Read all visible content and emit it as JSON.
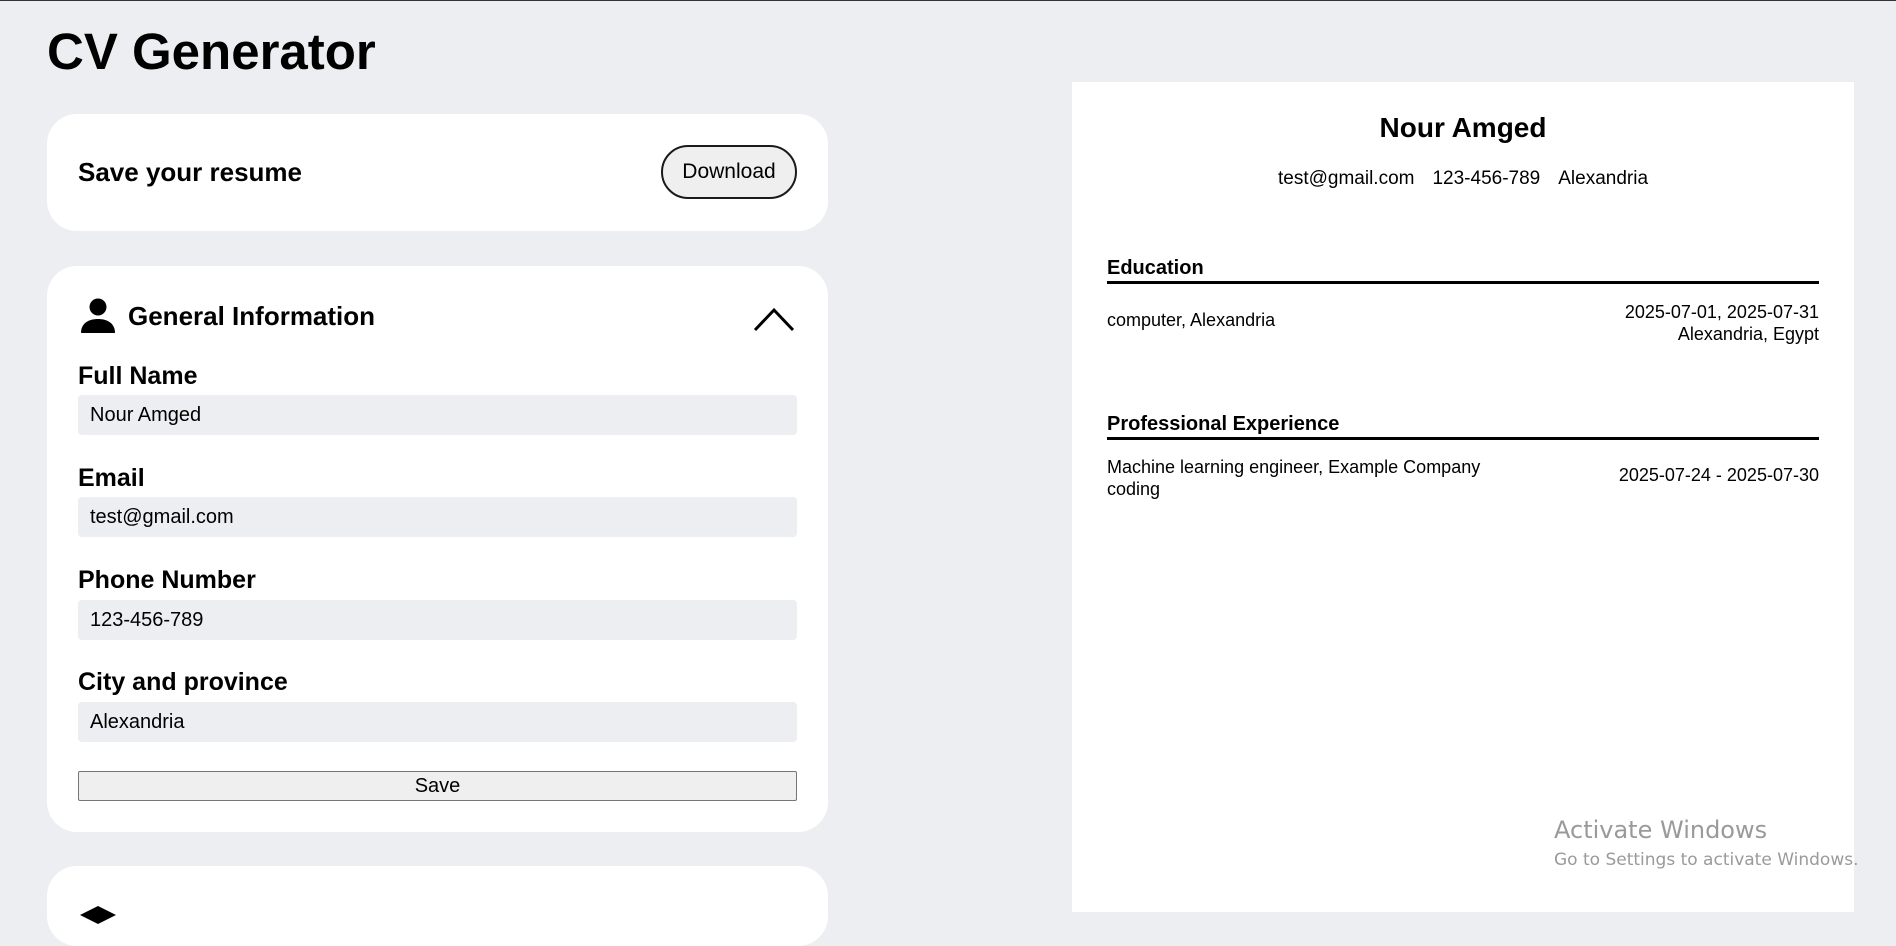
{
  "app": {
    "title": "CV Generator"
  },
  "save_card": {
    "label": "Save your resume",
    "download_label": "Download"
  },
  "general_info": {
    "title": "General Information",
    "icon": "person-icon",
    "collapse_icon": "chevron-up-icon",
    "fields": {
      "full_name": {
        "label": "Full Name",
        "value": "Nour Amged"
      },
      "email": {
        "label": "Email",
        "value": "test@gmail.com"
      },
      "phone": {
        "label": "Phone Number",
        "value": "123-456-789"
      },
      "city": {
        "label": "City and province",
        "value": "Alexandria"
      }
    },
    "save_label": "Save"
  },
  "resume": {
    "name": "Nour Amged",
    "email": "test@gmail.com",
    "phone": "123-456-789",
    "city": "Alexandria",
    "education": {
      "title": "Education",
      "entry": {
        "school": "computer, Alexandria",
        "dates": "2025-07-01, 2025-07-31",
        "location": "Alexandria, Egypt"
      }
    },
    "experience": {
      "title": "Professional Experience",
      "entry": {
        "position": "Machine learning engineer, Example Company",
        "description": "coding",
        "dates": "2025-07-24 - 2025-07-30"
      }
    }
  },
  "watermark": {
    "title": "Activate Windows",
    "subtitle": "Go to Settings to activate Windows."
  }
}
